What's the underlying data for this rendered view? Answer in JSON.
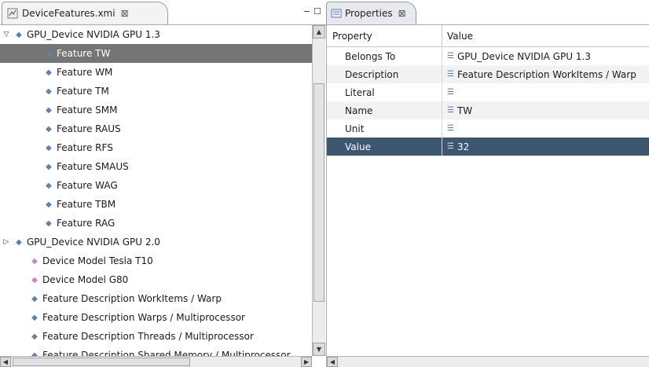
{
  "editor": {
    "tab_title": "DeviceFeatures.xmi",
    "tab_close": "⊠",
    "minimize_label": "−",
    "maximize_label": "☐"
  },
  "tree": {
    "rows": [
      {
        "label": "GPU_Device NVIDIA GPU 1.3",
        "twisty": "▽",
        "icon": "blue-diamond-icon",
        "selected": false
      },
      {
        "label": "Feature TW",
        "twisty": "",
        "icon": "blue-diamond-icon",
        "selected": true
      },
      {
        "label": "Feature WM",
        "twisty": "",
        "icon": "blue-diamond-icon",
        "selected": false
      },
      {
        "label": "Feature TM",
        "twisty": "",
        "icon": "blue-diamond-icon",
        "selected": false
      },
      {
        "label": "Feature SMM",
        "twisty": "",
        "icon": "blue-diamond-icon",
        "selected": false
      },
      {
        "label": "Feature RAUS",
        "twisty": "",
        "icon": "blue-diamond-icon",
        "selected": false
      },
      {
        "label": "Feature RFS",
        "twisty": "",
        "icon": "blue-diamond-icon",
        "selected": false
      },
      {
        "label": "Feature SMAUS",
        "twisty": "",
        "icon": "blue-diamond-icon",
        "selected": false
      },
      {
        "label": "Feature WAG",
        "twisty": "",
        "icon": "blue-diamond-icon",
        "selected": false
      },
      {
        "label": "Feature TBM",
        "twisty": "",
        "icon": "blue-diamond-icon",
        "selected": false
      },
      {
        "label": "Feature RAG",
        "twisty": "",
        "icon": "blue-diamond-icon",
        "selected": false
      },
      {
        "label": "GPU_Device NVIDIA GPU 2.0",
        "twisty": "▷",
        "icon": "blue-diamond-icon",
        "selected": false
      },
      {
        "label": "Device Model Tesla T10",
        "twisty": "",
        "icon": "pink-diamond-icon",
        "selected": false
      },
      {
        "label": "Device Model G80",
        "twisty": "",
        "icon": "pink-diamond-icon",
        "selected": false
      },
      {
        "label": "Feature Description WorkItems / Warp",
        "twisty": "",
        "icon": "blue-diamond-icon",
        "selected": false
      },
      {
        "label": "Feature Description Warps / Multiprocessor",
        "twisty": "",
        "icon": "blue-diamond-icon",
        "selected": false
      },
      {
        "label": "Feature Description Threads / Multiprocessor",
        "twisty": "",
        "icon": "blue-diamond-icon",
        "selected": false
      },
      {
        "label": "Feature Description Shared Memory / Multiprocessor",
        "twisty": "",
        "icon": "blue-diamond-icon",
        "selected": false
      }
    ]
  },
  "scroll": {
    "up_arrow": "▲",
    "down_arrow": "▼",
    "left_arrow": "◀",
    "right_arrow": "▶"
  },
  "properties": {
    "tab_title": "Properties",
    "tab_close": "⊠",
    "header_property": "Property",
    "header_value": "Value",
    "rows": [
      {
        "property": "Belongs To",
        "value": "GPU_Device NVIDIA GPU 1.3",
        "selected": false
      },
      {
        "property": "Description",
        "value": "Feature Description WorkItems / Warp",
        "selected": false
      },
      {
        "property": "Literal",
        "value": "",
        "selected": false
      },
      {
        "property": "Name",
        "value": "TW",
        "selected": false
      },
      {
        "property": "Unit",
        "value": "",
        "selected": false
      },
      {
        "property": "Value",
        "value": "32",
        "selected": true
      }
    ]
  },
  "colors": {
    "tree_selection": "#757575",
    "props_selection": "#3e5771",
    "tree_icon_blue": "#5d7fb6",
    "tree_icon_pink": "#c48ac7"
  }
}
